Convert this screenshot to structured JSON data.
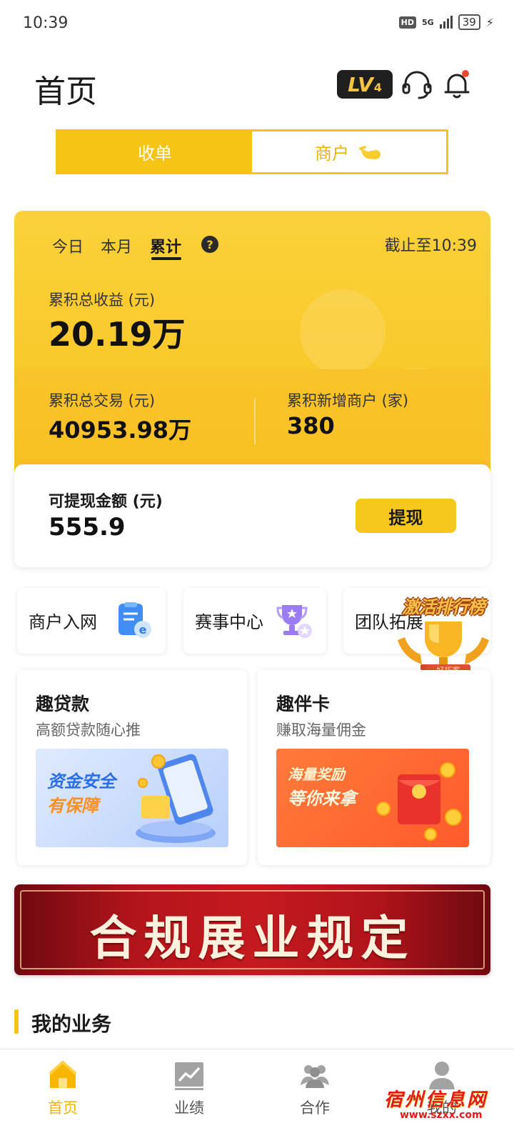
{
  "status_bar": {
    "time": "10:39",
    "hd": "HD",
    "network": "5G",
    "battery": "39"
  },
  "header": {
    "title": "首页",
    "level_badge": "LV",
    "level_number": "4",
    "icons": [
      "headset-icon",
      "bell-icon"
    ]
  },
  "segment_tabs": [
    {
      "label": "收单",
      "active": true
    },
    {
      "label": "商户",
      "active": false
    }
  ],
  "stats": {
    "periods": [
      "今日",
      "本月",
      "累计"
    ],
    "active_period": "累计",
    "help": "?",
    "as_of": "截止至10:39",
    "total_income_label": "累积总收益 (元)",
    "total_income_value": "20.19万",
    "total_trade_label": "累积总交易 (元)",
    "total_trade_value": "40953.98万",
    "new_merchants_label": "累积新增商户 (家)",
    "new_merchants_value": "380"
  },
  "withdraw": {
    "label": "可提现金额 (元)",
    "value": "555.9",
    "button": "提现"
  },
  "quick_entries": [
    {
      "label": "商户入网",
      "icon": "form-document-icon"
    },
    {
      "label": "赛事中心",
      "icon": "trophy-icon"
    },
    {
      "label": "团队拓展",
      "icon": "team-icon"
    }
  ],
  "ranking_badge": {
    "title": "激活排行榜",
    "tag": "好拓客"
  },
  "products": [
    {
      "title": "趣贷款",
      "subtitle": "高额贷款随心推",
      "banner_line1": "资金安全",
      "banner_line2": "有保障"
    },
    {
      "title": "趣伴卡",
      "subtitle": "赚取海量佣金",
      "banner_line1": "海量奖励",
      "banner_line2": "等你来拿"
    }
  ],
  "compliance_banner": "合规展业规定",
  "section_title": "我的业务",
  "bottom_nav": [
    {
      "label": "首页",
      "icon": "home-icon",
      "active": true
    },
    {
      "label": "业绩",
      "icon": "chart-icon",
      "active": false
    },
    {
      "label": "合作",
      "icon": "partners-icon",
      "active": false
    },
    {
      "label": "我的",
      "icon": "profile-icon",
      "active": false
    }
  ],
  "watermark": {
    "text": "宿州信息网",
    "url": "www.szxx.com"
  },
  "colors": {
    "brand_yellow": "#f6c415",
    "badge_dark": "#1f1f1f",
    "banner_red": "#c41a1f",
    "notification_dot": "#f0442c"
  }
}
